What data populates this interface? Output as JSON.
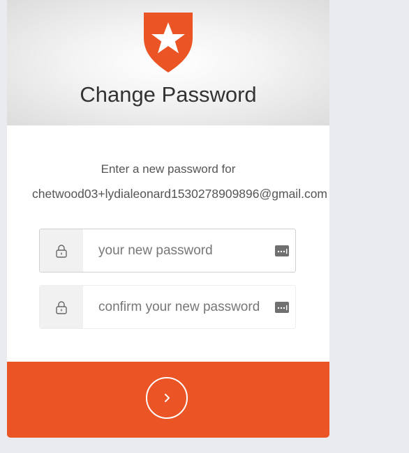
{
  "header": {
    "title": "Change Password",
    "logo_icon": "auth0-shield-star-logo",
    "accent_color": "#eb5424"
  },
  "message": {
    "line1": "Enter a new password for",
    "email": "chetwood03+lydialeonard1530278909896@gmail.com"
  },
  "fields": {
    "new_password": {
      "placeholder": "your new password",
      "value": "",
      "icon": "lock-icon",
      "trailing_icon": "password-manager-icon"
    },
    "confirm_password": {
      "placeholder": "confirm your new password",
      "value": "",
      "icon": "lock-icon",
      "trailing_icon": "password-manager-icon"
    }
  },
  "submit": {
    "icon": "chevron-right-icon",
    "color": "#eb5424"
  }
}
